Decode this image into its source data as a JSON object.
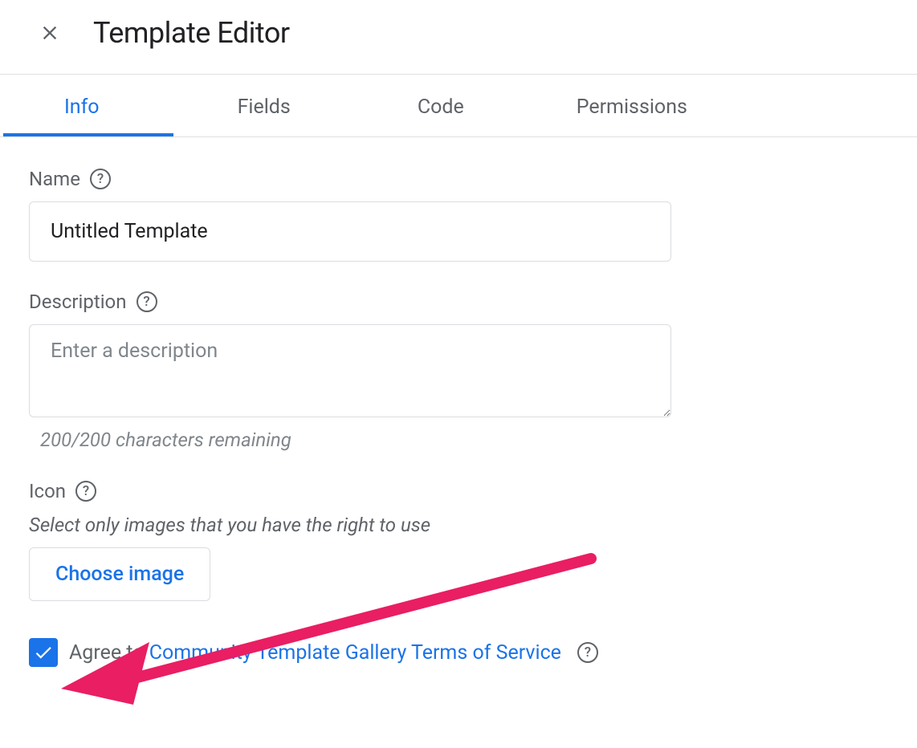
{
  "header": {
    "title": "Template Editor"
  },
  "tabs": {
    "items": [
      {
        "label": "Info",
        "active": true
      },
      {
        "label": "Fields",
        "active": false
      },
      {
        "label": "Code",
        "active": false
      },
      {
        "label": "Permissions",
        "active": false
      }
    ]
  },
  "form": {
    "name": {
      "label": "Name",
      "value": "Untitled Template"
    },
    "description": {
      "label": "Description",
      "placeholder": "Enter a description",
      "value": "",
      "char_counter": "200/200 characters remaining"
    },
    "icon": {
      "label": "Icon",
      "hint": "Select only images that you have the right to use",
      "button_label": "Choose image"
    },
    "agree": {
      "checked": true,
      "prefix": "Agree to ",
      "link_text": "Community Template Gallery Terms of Service"
    }
  }
}
